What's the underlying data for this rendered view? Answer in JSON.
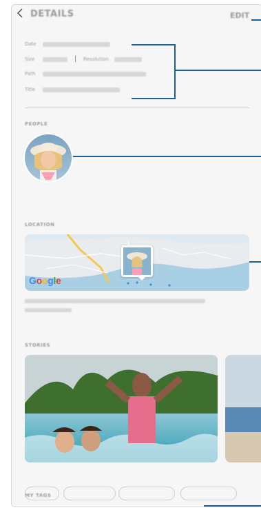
{
  "header": {
    "title": "DETAILS",
    "edit_label": "EDIT"
  },
  "info": {
    "labels": [
      "Date",
      "Size",
      "Path",
      "Title"
    ],
    "separator": "|",
    "resolution_label": "Resolution"
  },
  "sections": {
    "people": "PEOPLE",
    "location": "LOCATION",
    "stories": "STORIES",
    "tags": "MY TAGS"
  },
  "map": {
    "provider_logo": "Google"
  },
  "colors": {
    "callout": "#1c5f96",
    "map_water": "#a9cfe4",
    "map_land": "#e8ecef"
  }
}
